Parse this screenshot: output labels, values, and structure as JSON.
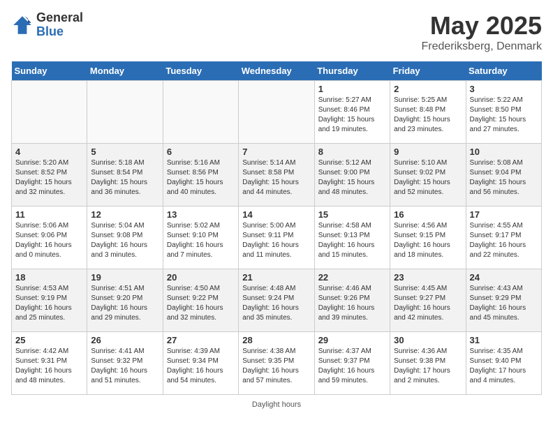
{
  "header": {
    "logo_general": "General",
    "logo_blue": "Blue",
    "month": "May 2025",
    "location": "Frederiksberg, Denmark"
  },
  "days": [
    "Sunday",
    "Monday",
    "Tuesday",
    "Wednesday",
    "Thursday",
    "Friday",
    "Saturday"
  ],
  "weeks": [
    [
      {
        "date": "",
        "info": ""
      },
      {
        "date": "",
        "info": ""
      },
      {
        "date": "",
        "info": ""
      },
      {
        "date": "",
        "info": ""
      },
      {
        "date": "1",
        "info": "Sunrise: 5:27 AM\nSunset: 8:46 PM\nDaylight: 15 hours\nand 19 minutes."
      },
      {
        "date": "2",
        "info": "Sunrise: 5:25 AM\nSunset: 8:48 PM\nDaylight: 15 hours\nand 23 minutes."
      },
      {
        "date": "3",
        "info": "Sunrise: 5:22 AM\nSunset: 8:50 PM\nDaylight: 15 hours\nand 27 minutes."
      }
    ],
    [
      {
        "date": "4",
        "info": "Sunrise: 5:20 AM\nSunset: 8:52 PM\nDaylight: 15 hours\nand 32 minutes."
      },
      {
        "date": "5",
        "info": "Sunrise: 5:18 AM\nSunset: 8:54 PM\nDaylight: 15 hours\nand 36 minutes."
      },
      {
        "date": "6",
        "info": "Sunrise: 5:16 AM\nSunset: 8:56 PM\nDaylight: 15 hours\nand 40 minutes."
      },
      {
        "date": "7",
        "info": "Sunrise: 5:14 AM\nSunset: 8:58 PM\nDaylight: 15 hours\nand 44 minutes."
      },
      {
        "date": "8",
        "info": "Sunrise: 5:12 AM\nSunset: 9:00 PM\nDaylight: 15 hours\nand 48 minutes."
      },
      {
        "date": "9",
        "info": "Sunrise: 5:10 AM\nSunset: 9:02 PM\nDaylight: 15 hours\nand 52 minutes."
      },
      {
        "date": "10",
        "info": "Sunrise: 5:08 AM\nSunset: 9:04 PM\nDaylight: 15 hours\nand 56 minutes."
      }
    ],
    [
      {
        "date": "11",
        "info": "Sunrise: 5:06 AM\nSunset: 9:06 PM\nDaylight: 16 hours\nand 0 minutes."
      },
      {
        "date": "12",
        "info": "Sunrise: 5:04 AM\nSunset: 9:08 PM\nDaylight: 16 hours\nand 3 minutes."
      },
      {
        "date": "13",
        "info": "Sunrise: 5:02 AM\nSunset: 9:10 PM\nDaylight: 16 hours\nand 7 minutes."
      },
      {
        "date": "14",
        "info": "Sunrise: 5:00 AM\nSunset: 9:11 PM\nDaylight: 16 hours\nand 11 minutes."
      },
      {
        "date": "15",
        "info": "Sunrise: 4:58 AM\nSunset: 9:13 PM\nDaylight: 16 hours\nand 15 minutes."
      },
      {
        "date": "16",
        "info": "Sunrise: 4:56 AM\nSunset: 9:15 PM\nDaylight: 16 hours\nand 18 minutes."
      },
      {
        "date": "17",
        "info": "Sunrise: 4:55 AM\nSunset: 9:17 PM\nDaylight: 16 hours\nand 22 minutes."
      }
    ],
    [
      {
        "date": "18",
        "info": "Sunrise: 4:53 AM\nSunset: 9:19 PM\nDaylight: 16 hours\nand 25 minutes."
      },
      {
        "date": "19",
        "info": "Sunrise: 4:51 AM\nSunset: 9:20 PM\nDaylight: 16 hours\nand 29 minutes."
      },
      {
        "date": "20",
        "info": "Sunrise: 4:50 AM\nSunset: 9:22 PM\nDaylight: 16 hours\nand 32 minutes."
      },
      {
        "date": "21",
        "info": "Sunrise: 4:48 AM\nSunset: 9:24 PM\nDaylight: 16 hours\nand 35 minutes."
      },
      {
        "date": "22",
        "info": "Sunrise: 4:46 AM\nSunset: 9:26 PM\nDaylight: 16 hours\nand 39 minutes."
      },
      {
        "date": "23",
        "info": "Sunrise: 4:45 AM\nSunset: 9:27 PM\nDaylight: 16 hours\nand 42 minutes."
      },
      {
        "date": "24",
        "info": "Sunrise: 4:43 AM\nSunset: 9:29 PM\nDaylight: 16 hours\nand 45 minutes."
      }
    ],
    [
      {
        "date": "25",
        "info": "Sunrise: 4:42 AM\nSunset: 9:31 PM\nDaylight: 16 hours\nand 48 minutes."
      },
      {
        "date": "26",
        "info": "Sunrise: 4:41 AM\nSunset: 9:32 PM\nDaylight: 16 hours\nand 51 minutes."
      },
      {
        "date": "27",
        "info": "Sunrise: 4:39 AM\nSunset: 9:34 PM\nDaylight: 16 hours\nand 54 minutes."
      },
      {
        "date": "28",
        "info": "Sunrise: 4:38 AM\nSunset: 9:35 PM\nDaylight: 16 hours\nand 57 minutes."
      },
      {
        "date": "29",
        "info": "Sunrise: 4:37 AM\nSunset: 9:37 PM\nDaylight: 16 hours\nand 59 minutes."
      },
      {
        "date": "30",
        "info": "Sunrise: 4:36 AM\nSunset: 9:38 PM\nDaylight: 17 hours\nand 2 minutes."
      },
      {
        "date": "31",
        "info": "Sunrise: 4:35 AM\nSunset: 9:40 PM\nDaylight: 17 hours\nand 4 minutes."
      }
    ]
  ],
  "footer": {
    "daylight_label": "Daylight hours"
  }
}
